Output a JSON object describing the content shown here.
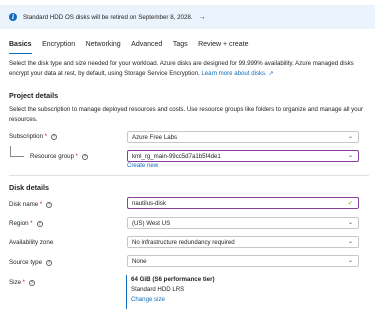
{
  "banner": {
    "text": "Standard HDD OS disks will be retired on September 8, 2028.",
    "arrow": "→"
  },
  "tabs": [
    {
      "label": "Basics",
      "active": true
    },
    {
      "label": "Encryption"
    },
    {
      "label": "Networking"
    },
    {
      "label": "Advanced"
    },
    {
      "label": "Tags"
    },
    {
      "label": "Review + create"
    }
  ],
  "intro": {
    "text": "Select the disk type and size needed for your workload. Azure disks are designed for 99.999% availability. Azure managed disks encrypt your data at rest, by default, using Storage Service Encryption. ",
    "link": "Learn more about disks."
  },
  "project_details": {
    "heading": "Project details",
    "description": "Select the subscription to manage deployed resources and costs. Use resource groups like folders to organize and manage all your resources.",
    "subscription": {
      "label": "Subscription",
      "required": "*",
      "value": "Azure Free Labs"
    },
    "resource_group": {
      "label": "Resource group",
      "required": "*",
      "value": "kml_rg_main-99cc5d7a1b5f4de1",
      "create_new": "Create new"
    }
  },
  "disk_details": {
    "heading": "Disk details",
    "disk_name": {
      "label": "Disk name",
      "required": "*",
      "value": "nautilus-disk"
    },
    "region": {
      "label": "Region",
      "required": "*",
      "value": "(US) West US"
    },
    "availability_zone": {
      "label": "Availability zone",
      "value": "No infrastructure redundancy required"
    },
    "source_type": {
      "label": "Source type",
      "value": "None"
    },
    "size": {
      "label": "Size",
      "required": "*",
      "title": "64 GiB (S6 performance tier)",
      "sku": "Standard HDD LRS",
      "change": "Change size"
    }
  },
  "colors": {
    "accent": "#0f6cbd",
    "focus_border": "#8a3f9b",
    "required": "#c50f1f",
    "banner_bg": "#ebf3fc"
  },
  "icons": {
    "info": "info-icon",
    "question": "question-icon",
    "chevron": "chevron-down-icon",
    "check": "check-icon",
    "external": "external-link-icon"
  }
}
